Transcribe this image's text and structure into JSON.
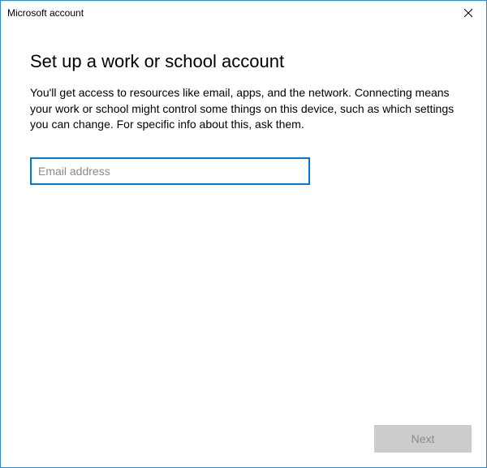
{
  "window": {
    "title": "Microsoft account"
  },
  "main": {
    "heading": "Set up a work or school account",
    "body": "You'll get access to resources like email, apps, and the network. Connecting means your work or school might control some things on this device, such as which settings you can change. For specific info about this, ask them.",
    "email": {
      "placeholder": "Email address",
      "value": ""
    }
  },
  "footer": {
    "next_label": "Next"
  }
}
